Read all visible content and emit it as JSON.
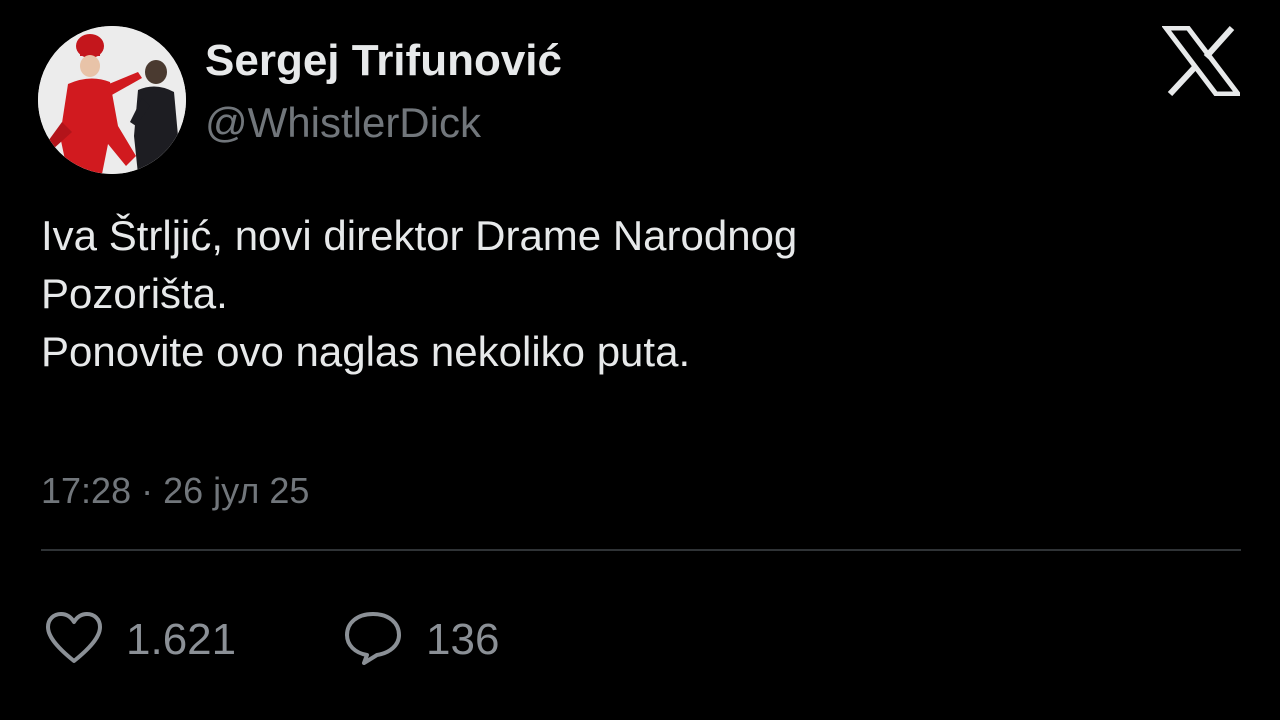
{
  "author": {
    "display_name": "Sergej Trifunović",
    "handle": "@WhistlerDick"
  },
  "platform_icon": "x-logo-icon",
  "tweet": {
    "lines": [
      "Iva Štrljić, novi direktor Drame Narodnog",
      "Pozorišta.",
      "Ponovite ovo naglas nekoliko puta."
    ],
    "timestamp": "17:28 · 26 јул 25"
  },
  "actions": {
    "likes": {
      "icon": "heart-icon",
      "count": "1.621"
    },
    "replies": {
      "icon": "reply-bubble-icon",
      "count": "136"
    }
  },
  "colors": {
    "background": "#000000",
    "primary_text": "#e7e9ea",
    "secondary_text": "#71767b",
    "divider": "#2f3336"
  }
}
